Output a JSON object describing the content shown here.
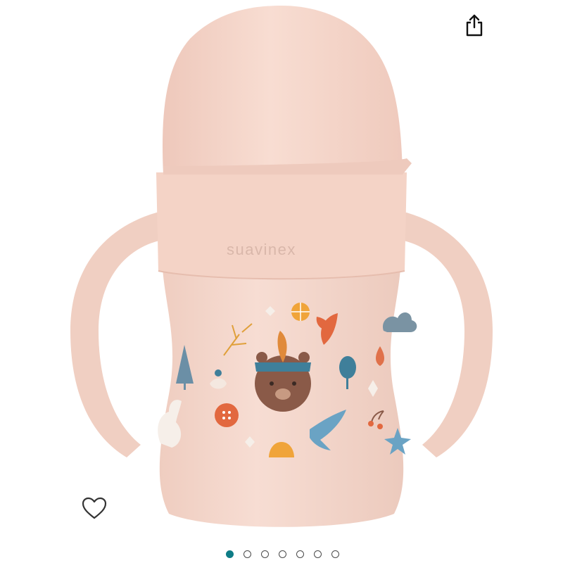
{
  "product": {
    "brand_embossed": "suavinex",
    "bottle_color": "#f5d6ca"
  },
  "gallery": {
    "image_count": 7,
    "active_index": 0,
    "active_color": "#0f7c86"
  },
  "actions": {
    "share_icon": "share-icon",
    "wishlist_icon": "heart-outline-icon"
  }
}
